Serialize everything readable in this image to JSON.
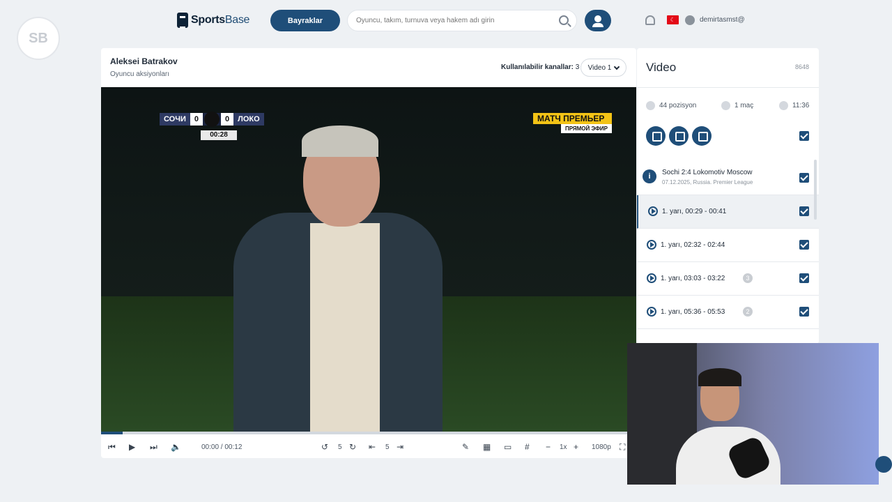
{
  "brand": {
    "name_bold": "Sports",
    "name_rest": "Base",
    "side_logo": "SB"
  },
  "topbar": {
    "flags_button": "Bayraklar",
    "search_placeholder": "Oyuncu, takım, turnuva veya hakem adı girin",
    "username": "demirtasmst@"
  },
  "card": {
    "title": "Aleksei Batrakov",
    "subtitle": "Oyuncu aksiyonları",
    "channels_label": "Kullanılabilir kanallar:",
    "channels_count": "3",
    "video_select": "Video 1"
  },
  "video": {
    "home_team": "СОЧИ",
    "home_score": "0",
    "away_score": "0",
    "away_team": "ЛОКО",
    "clock": "00:28",
    "broadcaster_top": "МАТЧ ПРЕМЬЕР",
    "broadcaster_bottom": "ПРЯМОЙ ЭФИР",
    "progress": 0.04
  },
  "controls": {
    "time": "00:00 / 00:12",
    "rewind_seconds": "5",
    "frame_step": "5",
    "speed": "1x",
    "quality": "1080p"
  },
  "panel": {
    "title": "Video",
    "id": "8648",
    "positions": "44 pozisyon",
    "matches": "1 maç",
    "duration": "11:36",
    "match_name": "Sochi 2:4 Lokomotiv Moscow",
    "match_meta": "07.12.2025, Russia. Premier League",
    "segments": [
      {
        "label": "1. yarı, 00:29 - 00:41",
        "badge": ""
      },
      {
        "label": "1. yarı, 02:32 - 02:44",
        "badge": ""
      },
      {
        "label": "1. yarı, 03:03 - 03:22",
        "badge": "3"
      },
      {
        "label": "1. yarı, 05:36 - 05:53",
        "badge": "2"
      }
    ]
  },
  "colors": {
    "primary": "#1f4e79",
    "background": "#eef1f4",
    "accent_flag": "#e30a17"
  }
}
